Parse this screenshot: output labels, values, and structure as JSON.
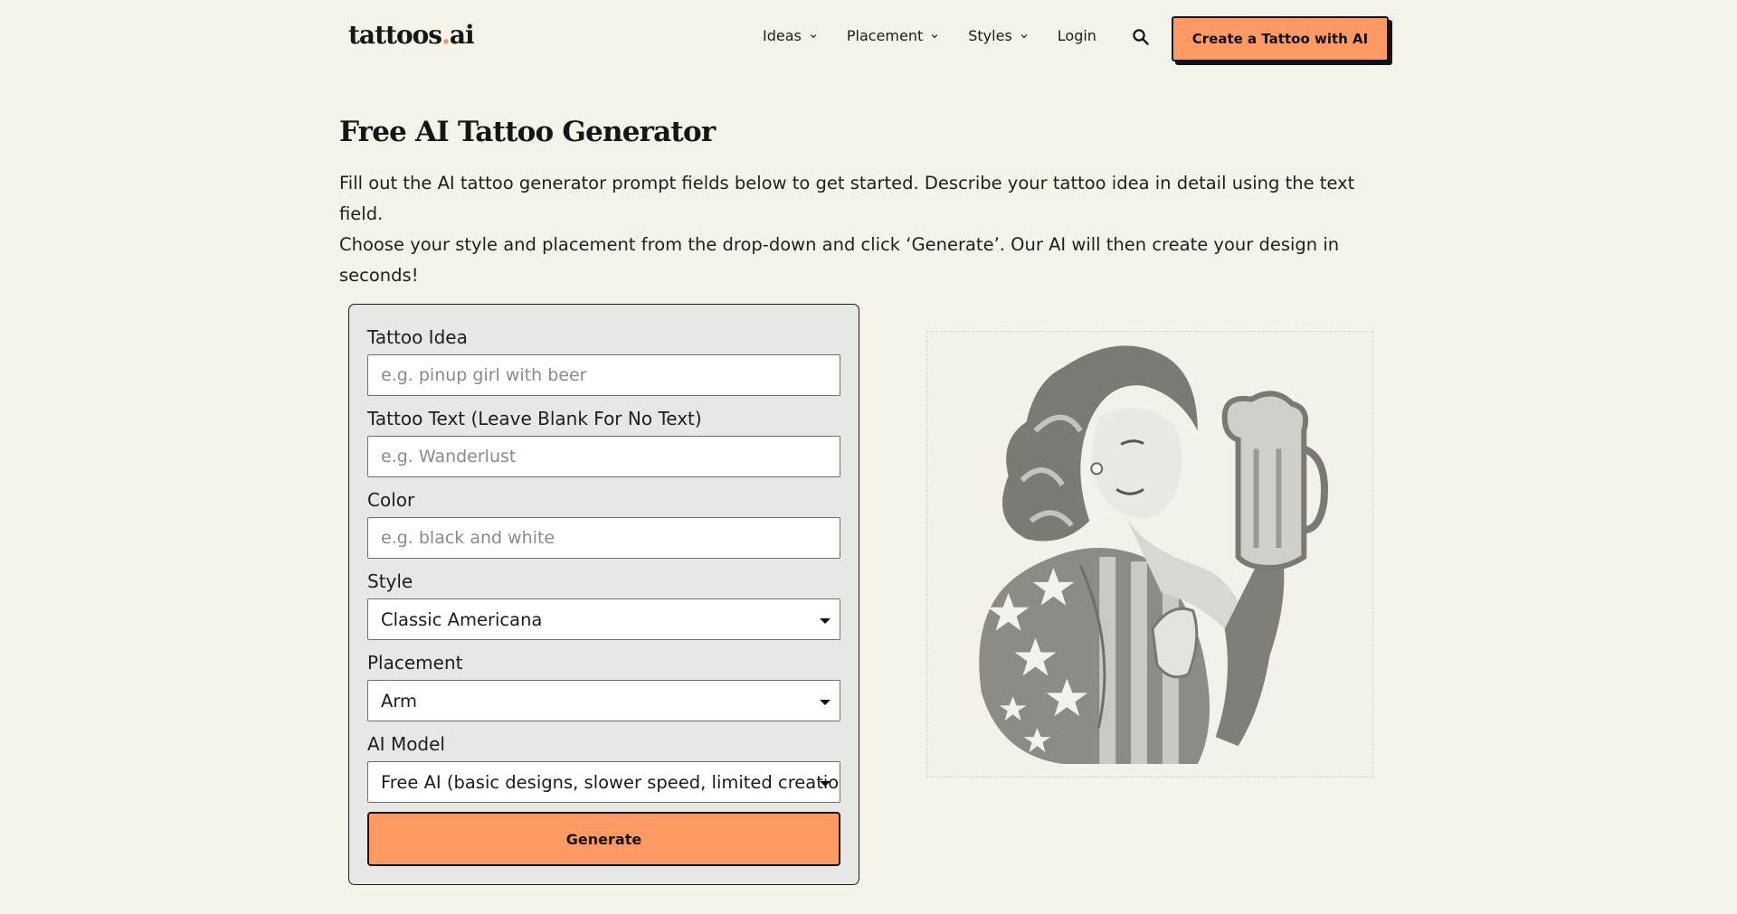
{
  "header": {
    "logo_main": "tattoos",
    "logo_dot": ".",
    "logo_suffix": "ai",
    "nav": [
      {
        "label": "Ideas"
      },
      {
        "label": "Placement"
      },
      {
        "label": "Styles"
      },
      {
        "label": "Login"
      }
    ],
    "cta_label": "Create a Tattoo with AI"
  },
  "page": {
    "title": "Free AI Tattoo Generator",
    "intro_line1": "Fill out the AI tattoo generator prompt fields below to get started. Describe your tattoo idea in detail using the text field.",
    "intro_line2": "Choose your style and placement from the drop-down and click ‘Generate’. Our AI will then create your design in seconds!"
  },
  "form": {
    "idea": {
      "label": "Tattoo Idea",
      "placeholder": "e.g. pinup girl with beer",
      "value": ""
    },
    "text": {
      "label": "Tattoo Text (Leave Blank For No Text)",
      "placeholder": "e.g. Wanderlust",
      "value": ""
    },
    "color": {
      "label": "Color",
      "placeholder": "e.g. black and white",
      "value": ""
    },
    "style": {
      "label": "Style",
      "selected": "Classic Americana"
    },
    "placement": {
      "label": "Placement",
      "selected": "Arm"
    },
    "model": {
      "label": "AI Model",
      "selected": "Free AI (basic designs, slower speed, limited creations)"
    },
    "generate_label": "Generate"
  },
  "preview": {
    "image_icon": "pinup-girl-with-beer-illustration"
  },
  "colors": {
    "background": "#f6f4ea",
    "accent": "#ff9a64",
    "logo_dot": "#f28a4a",
    "panel": "#e7e7e6"
  }
}
